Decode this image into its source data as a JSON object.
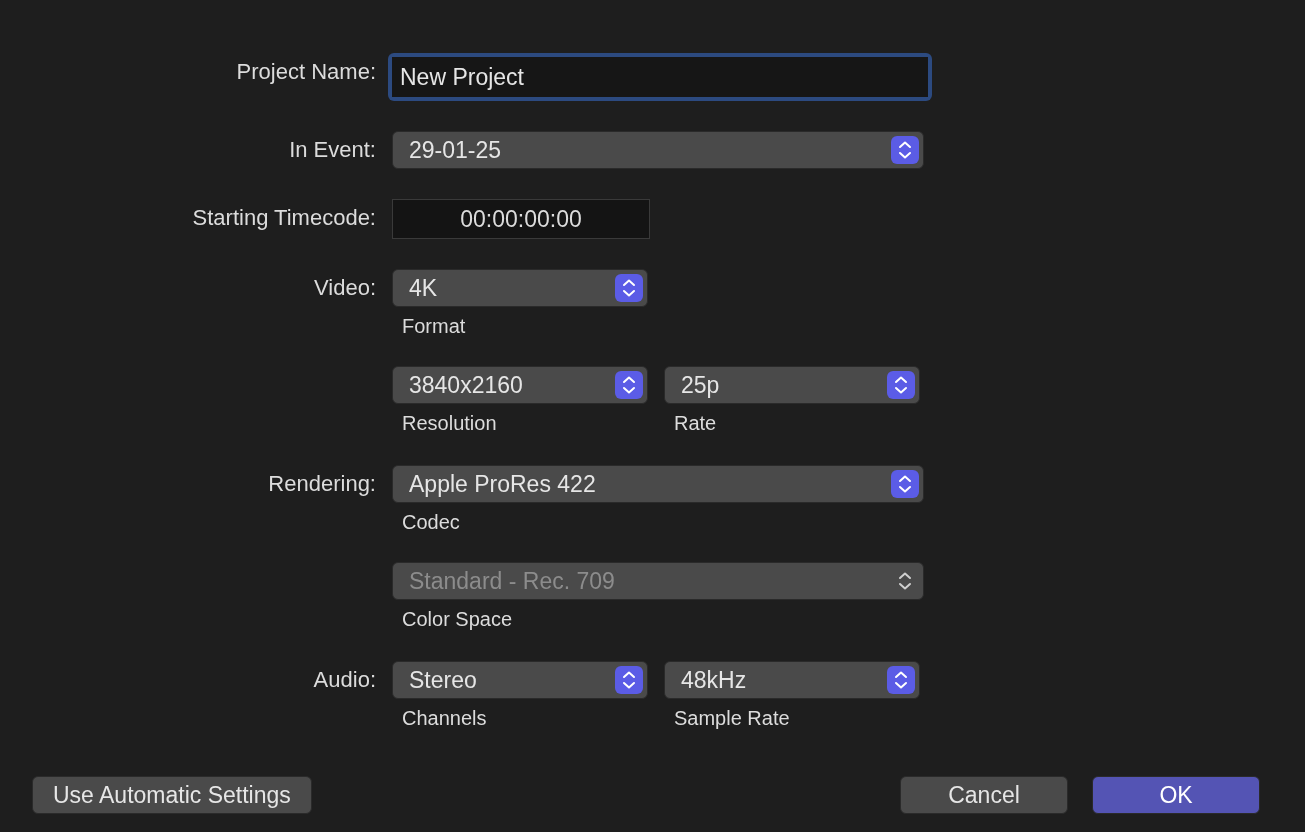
{
  "fields": [
    {
      "kind": "text",
      "label": "Project Name:",
      "value": "New Project",
      "focused": true
    },
    {
      "kind": "popups",
      "label": "In Event:",
      "groups": [
        [
          {
            "kind": "wide",
            "value": "29-01-25",
            "disabled": false
          }
        ]
      ]
    },
    {
      "kind": "timecode",
      "label": "Starting Timecode:",
      "value": "00:00:00:00"
    },
    {
      "kind": "popups",
      "label": "Video:",
      "groups": [
        [
          {
            "kind": "half",
            "value": "4K",
            "caption": "Format",
            "disabled": false
          }
        ],
        [
          {
            "kind": "half",
            "value": "3840x2160",
            "caption": "Resolution",
            "disabled": false
          },
          {
            "kind": "half",
            "value": "25p",
            "caption": "Rate",
            "disabled": false
          }
        ]
      ]
    },
    {
      "kind": "popups",
      "label": "Rendering:",
      "groups": [
        [
          {
            "kind": "wide",
            "value": "Apple ProRes 422",
            "caption": "Codec",
            "disabled": false
          }
        ],
        [
          {
            "kind": "wide",
            "value": "Standard - Rec. 709",
            "caption": "Color Space",
            "disabled": true
          }
        ]
      ]
    },
    {
      "kind": "popups",
      "label": "Audio:",
      "groups": [
        [
          {
            "kind": "half",
            "value": "Stereo",
            "caption": "Channels",
            "disabled": false
          },
          {
            "kind": "half",
            "value": "48kHz",
            "caption": "Sample Rate",
            "disabled": false
          }
        ]
      ]
    }
  ],
  "left_buttons": [
    {
      "label": "Use Automatic Settings",
      "default": false
    }
  ],
  "right_buttons": [
    {
      "label": "Cancel",
      "default": false
    },
    {
      "label": "OK",
      "default": true
    }
  ]
}
